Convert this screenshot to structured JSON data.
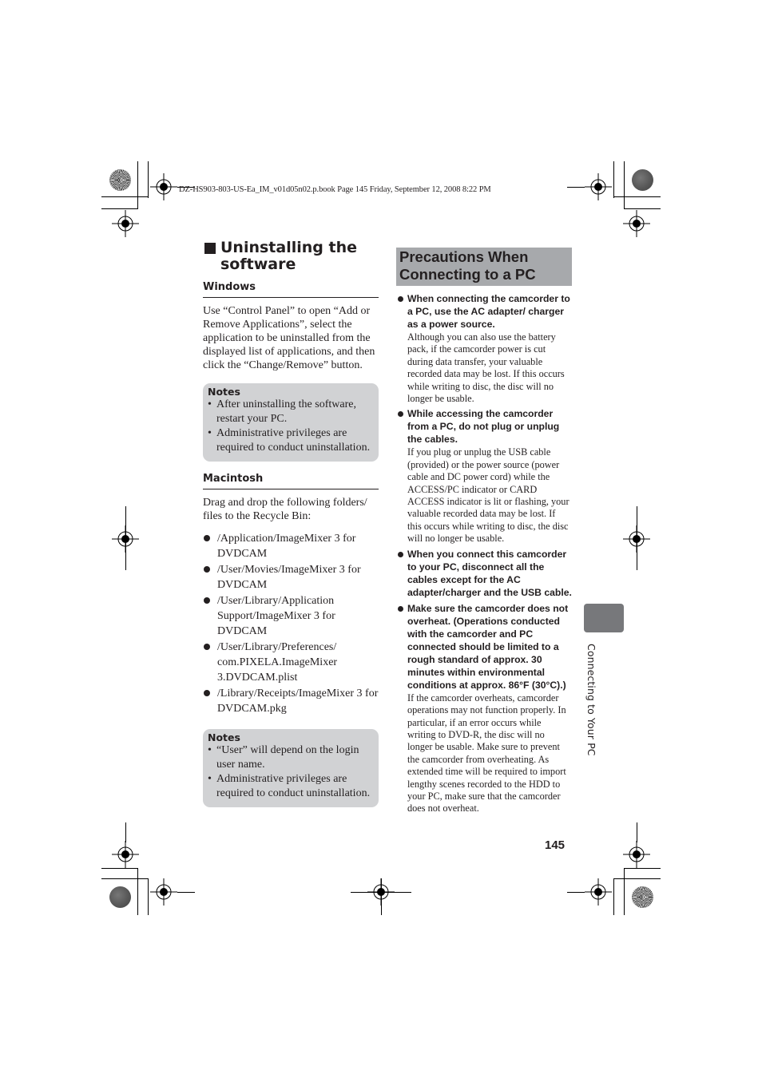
{
  "header": {
    "file_info": "DZ-HS903-803-US-Ea_IM_v01d05n02.p.book  Page 145  Friday, September 12, 2008  8:22 PM"
  },
  "left": {
    "section_title_line1": "Uninstalling the",
    "section_title_line2": "software",
    "windows": {
      "heading": "Windows",
      "body": "Use “Control Panel” to open “Add or Remove Applications”, select the application to be uninstalled from the displayed list of applications, and then click the “Change/Remove” button.",
      "notes_title": "Notes",
      "notes": [
        "After uninstalling the software, restart your PC.",
        "Administrative privileges are required to conduct uninstallation."
      ]
    },
    "macintosh": {
      "heading": "Macintosh",
      "body": "Drag and drop the following folders/ files to the Recycle Bin:",
      "paths": [
        "/Application/ImageMixer 3 for DVDCAM",
        "/User/Movies/ImageMixer 3 for DVDCAM",
        "/User/Library/Application Support/ImageMixer 3 for DVDCAM",
        "/User/Library/Preferences/ com.PIXELA.ImageMixer 3.DVDCAM.plist",
        "/Library/Receipts/ImageMixer 3 for DVDCAM.pkg"
      ],
      "notes_title": "Notes",
      "notes": [
        "“User” will depend on the login user name.",
        "Administrative privileges are required to conduct uninstallation."
      ]
    }
  },
  "right": {
    "banner_line1": "Precautions When",
    "banner_line2": "Connecting to a PC",
    "items": [
      {
        "head": "When connecting the camcorder to a PC, use the AC adapter/ charger as a power source.",
        "body": "Although you can also use the battery pack, if the camcorder power is cut during data transfer, your valuable recorded data may be lost. If this occurs while writing to disc, the disc will no longer be usable."
      },
      {
        "head": "While accessing the camcorder from a PC, do not plug or unplug the cables.",
        "body": "If you plug or unplug the USB cable (provided) or the power source (power cable and DC power cord) while the ACCESS/PC indicator or CARD ACCESS indicator is lit or flashing, your valuable recorded data may be lost. If this occurs while writing to disc, the disc will no longer be usable."
      },
      {
        "head": "When you connect this camcorder to your PC, disconnect all the cables except for the AC adapter/charger and the USB cable.",
        "body": ""
      },
      {
        "head": "Make sure the camcorder does not overheat. (Operations conducted with the camcorder and PC connected should be limited to a rough standard of approx. 30 minutes within environmental conditions at approx. 86°F (30°C).)",
        "body": "If the camcorder overheats, camcorder operations may not function properly. In particular, if an error occurs while writing to DVD-R, the disc will no longer be usable. Make sure to prevent the camcorder from overheating. As extended time will be required to import lengthy scenes recorded to the HDD to your PC, make sure that the camcorder does not overheat."
      }
    ]
  },
  "page_number": "145",
  "side_tab": {
    "label": "Connecting to Your PC",
    "color": "#77787b"
  },
  "colors": {
    "text": "#231f20",
    "notes_bg": "#d1d2d4",
    "banner_bg": "#a7a9ac"
  }
}
